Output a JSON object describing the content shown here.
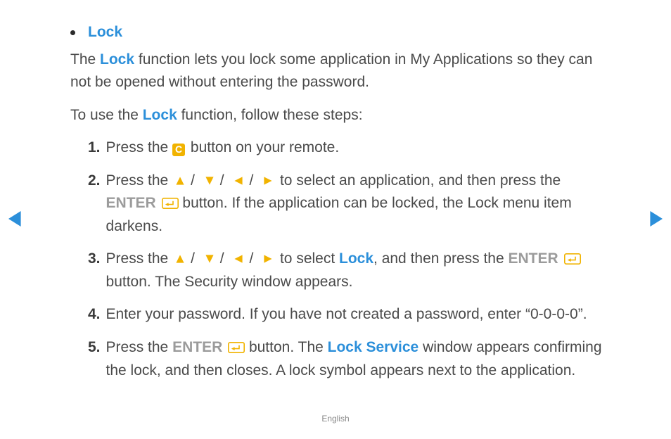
{
  "section": {
    "title": "Lock",
    "intro_before": "The ",
    "intro_em": "Lock",
    "intro_after": " function lets you lock some application in My Applications so they can not be opened without entering the password.",
    "prompt_before": "To use the ",
    "prompt_em": "Lock",
    "prompt_after": " function, follow these steps:"
  },
  "labels": {
    "c": "C",
    "enter": "ENTER",
    "slash": "/"
  },
  "steps": {
    "1": {
      "num": "1.",
      "a": "Press the ",
      "b": " button on your remote."
    },
    "2": {
      "num": "2.",
      "a": "Press the ",
      "b": " to select an application, and then press the ",
      "c": " button. If the application can be locked, the Lock menu item darkens."
    },
    "3": {
      "num": "3.",
      "a": "Press the ",
      "b": " to select ",
      "lock": "Lock",
      "c": ", and then press the ",
      "d": " button. The Security window appears."
    },
    "4": {
      "num": "4.",
      "a": "Enter your password. If you have not created a password, enter “0-0-0-0”."
    },
    "5": {
      "num": "5.",
      "a": "Press the ",
      "b": " button. The ",
      "svc": "Lock Service",
      "c": " window appears confirming the lock, and then closes. A lock symbol appears next to the application."
    }
  },
  "footer": "English"
}
